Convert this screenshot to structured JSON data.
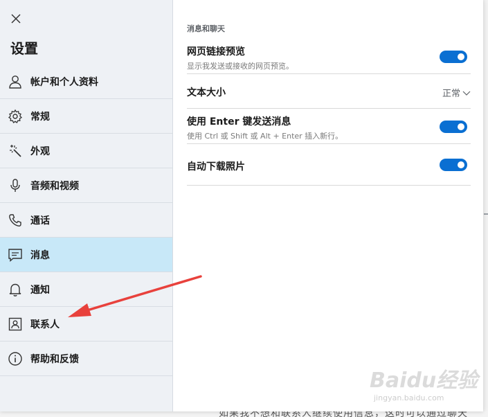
{
  "sidebar": {
    "title": "设置",
    "items": [
      {
        "label": "帐户和个人资料",
        "icon": "person-icon",
        "active": false
      },
      {
        "label": "常规",
        "icon": "gear-icon",
        "active": false
      },
      {
        "label": "外观",
        "icon": "magic-wand-icon",
        "active": false
      },
      {
        "label": "音频和视频",
        "icon": "microphone-icon",
        "active": false
      },
      {
        "label": "通话",
        "icon": "phone-icon",
        "active": false
      },
      {
        "label": "消息",
        "icon": "message-icon",
        "active": true
      },
      {
        "label": "通知",
        "icon": "bell-icon",
        "active": false
      },
      {
        "label": "联系人",
        "icon": "contact-card-icon",
        "active": false
      },
      {
        "label": "帮助和反馈",
        "icon": "info-icon",
        "active": false
      }
    ]
  },
  "main": {
    "section_title": "消息和聊天",
    "settings": [
      {
        "title": "网页链接预览",
        "description": "显示我发送或接收的网页预览。",
        "control": "toggle",
        "on": true
      },
      {
        "title": "文本大小",
        "control": "select",
        "value": "正常"
      },
      {
        "title": "使用 Enter 键发送消息",
        "description": "使用 Ctrl 或 Shift 或 Alt + Enter 插入新行。",
        "control": "toggle",
        "on": true
      },
      {
        "title": "自动下载照片",
        "control": "toggle",
        "on": true
      }
    ]
  },
  "background": {
    "bottom_text": "如果我不想和联系人继续使用信息，这时可以通过聊天"
  },
  "watermark": {
    "logo": "Baidu经验",
    "url": "jingyan.baidu.com"
  },
  "colors": {
    "accent": "#0a6fd2",
    "active_nav": "#c8e8f8",
    "sidebar_bg": "#eef1f5",
    "annotation_arrow": "#e8413c"
  }
}
